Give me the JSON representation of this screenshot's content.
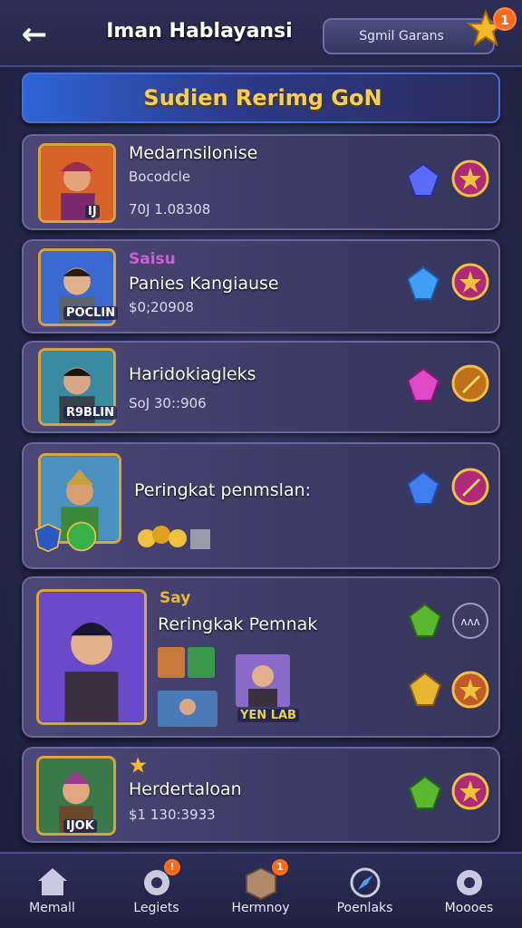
{
  "header": {
    "title": "Iman Hablayansi",
    "pill_label": "Sgmil Garans",
    "star_count": "1"
  },
  "banner": {
    "text": "Sudien Rerimg GoN"
  },
  "cards": [
    {
      "name": "Medarnsilonise",
      "sub1": "Bocodcle",
      "sub2": "70J 1.08308",
      "rank": "IJ"
    },
    {
      "tag": "Saisu",
      "name": "Panies Kangiause",
      "sub2": "$0;20908",
      "rank": "POCLIN"
    },
    {
      "name": "Haridokiagleks",
      "sub2": "SoJ 30::906",
      "rank": "R9BLIN"
    },
    {
      "name": "Peringkat penmslan:"
    },
    {
      "tag": "Say",
      "name": "Reringkak Pemnak",
      "badge": "YEN LAB"
    },
    {
      "name": "Herdertaloan",
      "sub2": "$1 130:3933",
      "rank": "IJOK"
    }
  ],
  "nav": [
    {
      "label": "Memall",
      "icon": "home-icon"
    },
    {
      "label": "Legiets",
      "icon": "gear-icon",
      "badge": "!"
    },
    {
      "label": "Hermnoy",
      "icon": "box-icon",
      "badge": "1"
    },
    {
      "label": "Poenlaks",
      "icon": "compass-icon"
    },
    {
      "label": "Moooes",
      "icon": "settings-icon"
    }
  ],
  "colors": {
    "accent_gold": "#f6cf4b",
    "badge_orange": "#ff6a1a",
    "card_bg": "#4d4777",
    "tag_purple": "#d25bd8",
    "tag_gold": "#e8b63a"
  }
}
